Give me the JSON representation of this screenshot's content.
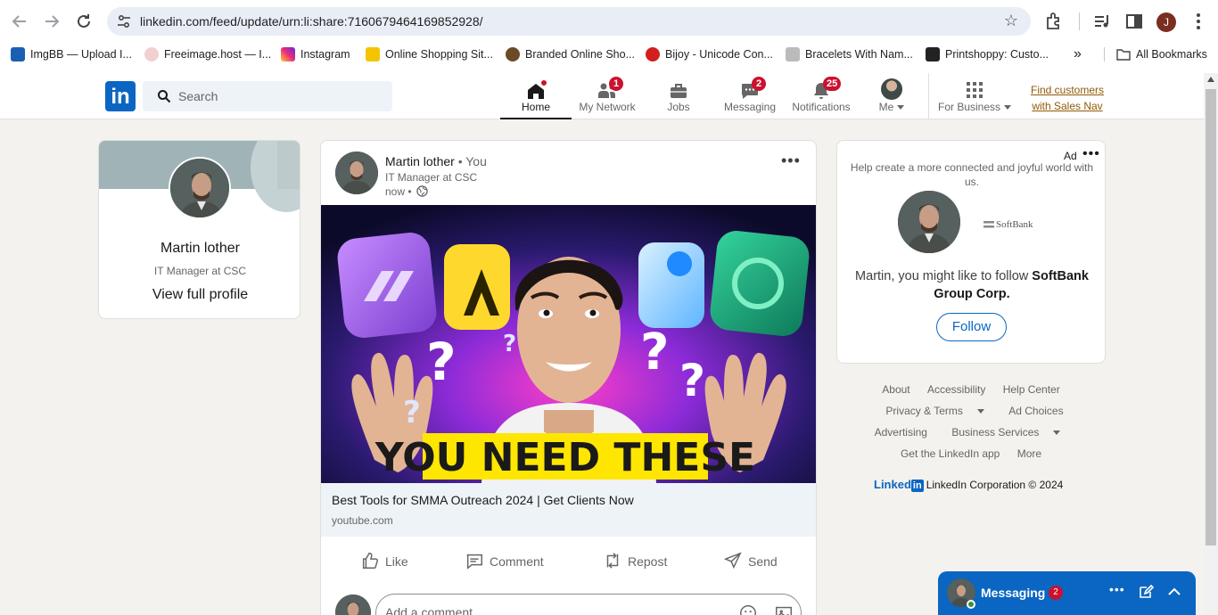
{
  "browser": {
    "url": "linkedin.com/feed/update/urn:li:share:7160679464169852928/",
    "profile_initial": "J",
    "bookmarks": [
      {
        "label": "ImgBB — Upload I...",
        "color": "#1a5fb4"
      },
      {
        "label": "Freeimage.host — I...",
        "color": "#e9a0a0"
      },
      {
        "label": "Instagram",
        "color": "#d6249f"
      },
      {
        "label": "Online Shopping Sit...",
        "color": "#f5c400"
      },
      {
        "label": "Branded Online Sho...",
        "color": "#6b4a25"
      },
      {
        "label": "Bijoy - Unicode Con...",
        "color": "#d11f1f"
      },
      {
        "label": "Bracelets With Nam...",
        "color": "#888888"
      },
      {
        "label": "Printshoppy: Custo...",
        "color": "#222222"
      }
    ],
    "all_bookmarks": "All Bookmarks"
  },
  "header": {
    "logo": "in",
    "search_placeholder": "Search",
    "nav": {
      "home": "Home",
      "network": "My Network",
      "jobs": "Jobs",
      "messaging": "Messaging",
      "notifications": "Notifications",
      "me": "Me",
      "business": "For Business"
    },
    "badges": {
      "network": "1",
      "messaging": "2",
      "notifications": "25"
    },
    "sales_nav": "Find customers with Sales Nav"
  },
  "profile": {
    "name": "Martin lother",
    "headline": "IT Manager at CSC",
    "link": "View full profile"
  },
  "post": {
    "author": "Martin lother",
    "you": "• You",
    "headline": "IT Manager at CSC",
    "time": "now •",
    "image_caption": "YOU NEED THESE",
    "link_title": "Best Tools for SMMA Outreach 2024 | Get Clients Now",
    "link_domain": "youtube.com",
    "actions": {
      "like": "Like",
      "comment": "Comment",
      "repost": "Repost",
      "send": "Send"
    },
    "comment_placeholder": "Add a comment..."
  },
  "ad": {
    "label": "Ad",
    "text": "Help create a more connected and joyful world with us.",
    "logo_text": "SoftBank",
    "follow_prefix": "Martin, you might like to follow",
    "company": "SoftBank Group Corp.",
    "follow_button": "Follow"
  },
  "footer": {
    "about": "About",
    "accessibility": "Accessibility",
    "help": "Help Center",
    "privacy": "Privacy & Terms",
    "ad_choices": "Ad Choices",
    "advertising": "Advertising",
    "business_services": "Business Services",
    "app": "Get the LinkedIn app",
    "more": "More",
    "brand_word": "Linked",
    "brand_in": "in",
    "copyright": "LinkedIn Corporation © 2024"
  },
  "messaging": {
    "title": "Messaging",
    "badge": "2"
  },
  "colors": {
    "brand": "#0a66c2",
    "badge": "#cb112d"
  }
}
